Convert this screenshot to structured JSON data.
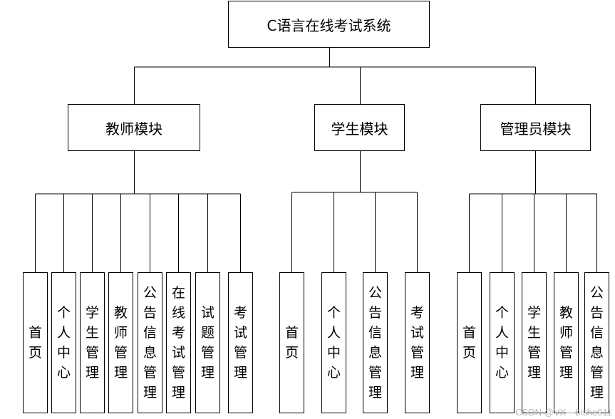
{
  "diagram": {
    "root": "C语言在线考试系统",
    "modules": [
      {
        "label": "教师模块",
        "children": [
          "首\n页",
          "个\n人\n中\n心",
          "学\n生\n管\n理",
          "教\n师\n管\n理",
          "公\n告\n信\n息\n管\n理",
          "在\n线\n考\n试\n管\n理",
          "试\n题\n管\n理",
          "考\n试\n管\n理"
        ]
      },
      {
        "label": "学生模块",
        "children": [
          "首\n页",
          "个\n人\n中\n心",
          "公\n告\n信\n息\n管\n理",
          "考\n试\n管\n理"
        ]
      },
      {
        "label": "管理员模块",
        "children": [
          "首\n页",
          "个\n人\n中\n心",
          "学\n生\n管\n理",
          "教\n师\n管\n理",
          "公\n告\n信\n息\n管\n理"
        ]
      }
    ]
  },
  "watermark": "CSDN @VX—bishe911"
}
